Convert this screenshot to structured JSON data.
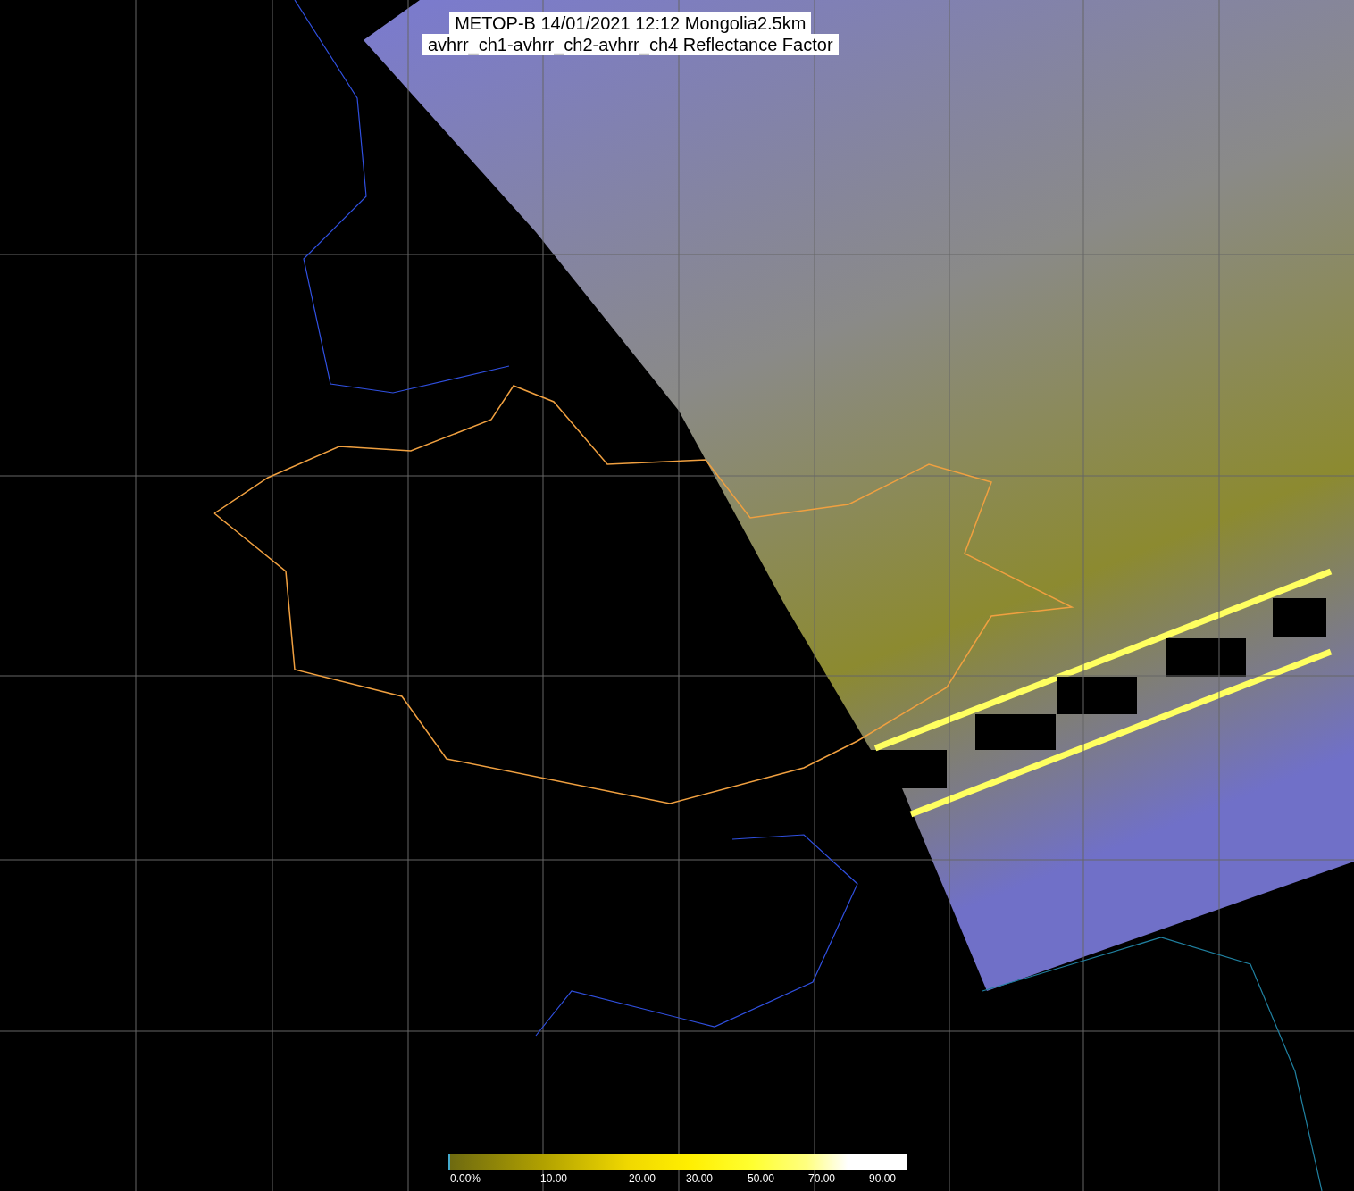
{
  "title": {
    "line_1": "METOP-B 14/01/2021 12:12 Mongolia2.5km",
    "line_2": "avhrr_ch1-avhrr_ch2-avhrr_ch4 Reflectance Factor"
  },
  "colorbar": {
    "ticks": [
      "0.00%",
      "10.00",
      "20.00",
      "30.00",
      "50.00",
      "70.00",
      "90.00"
    ]
  }
}
